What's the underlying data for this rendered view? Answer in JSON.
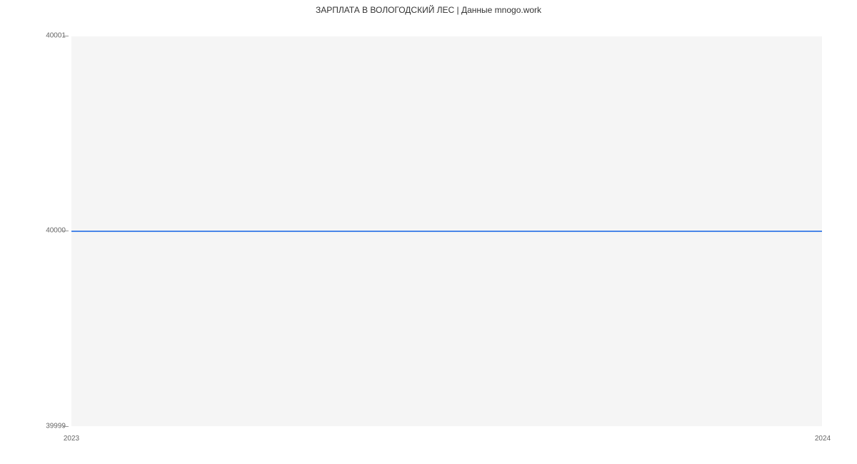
{
  "chart_data": {
    "type": "line",
    "title": "ЗАРПЛАТА В ВОЛОГОДСКИЙ ЛЕС | Данные mnogo.work",
    "x": [
      2023,
      2024
    ],
    "values": [
      40000,
      40000
    ],
    "xlim": [
      2023,
      2024
    ],
    "ylim": [
      39999,
      40001
    ],
    "y_ticks": [
      39999,
      40000,
      40001
    ],
    "x_ticks": [
      2023,
      2024
    ],
    "xlabel": "",
    "ylabel": ""
  }
}
